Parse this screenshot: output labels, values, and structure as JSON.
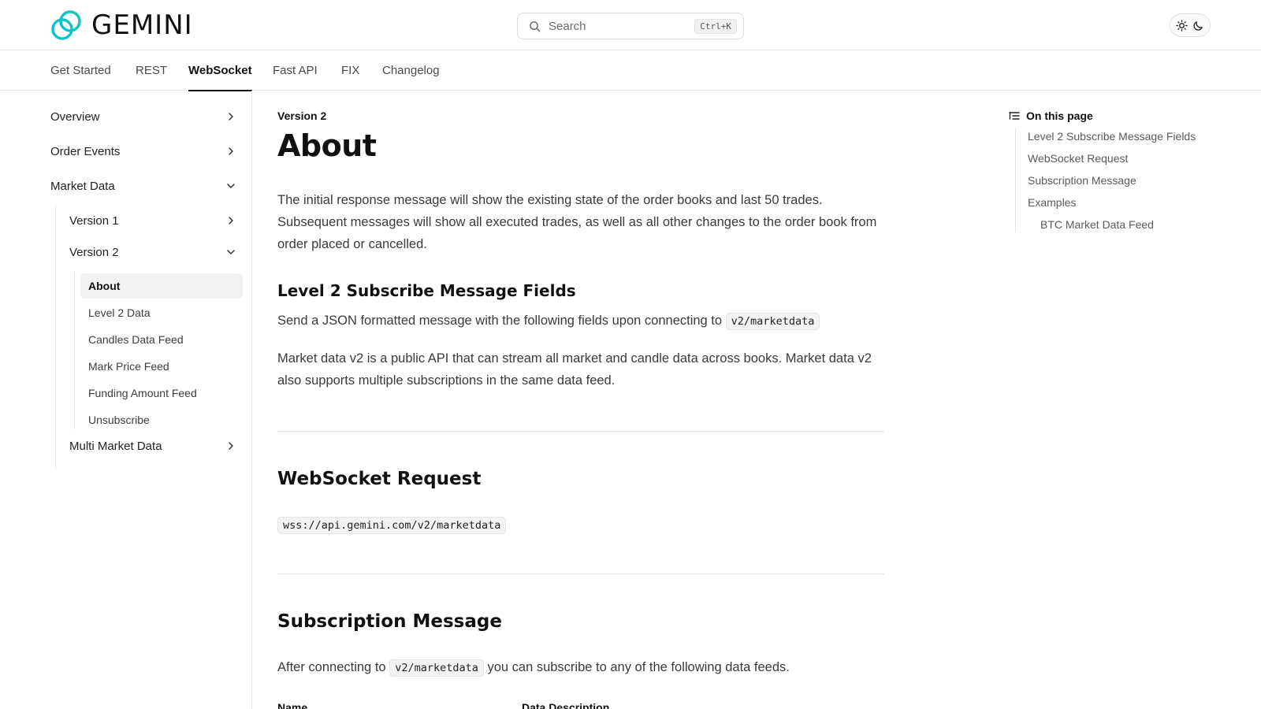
{
  "brand": {
    "name": "GEMINI",
    "logo_icon": "gemini-logo"
  },
  "search": {
    "placeholder": "Search",
    "shortcut": "Ctrl+K"
  },
  "theme": {
    "light_icon": "sun-icon",
    "dark_icon": "moon-icon"
  },
  "tabs": [
    {
      "label": "Get Started"
    },
    {
      "label": "REST"
    },
    {
      "label": "WebSocket",
      "active": true
    },
    {
      "label": "Fast API"
    },
    {
      "label": "FIX"
    },
    {
      "label": "Changelog"
    }
  ],
  "sidebar": {
    "sections": [
      {
        "label": "Overview",
        "state": "collapsed"
      },
      {
        "label": "Order Events",
        "state": "collapsed"
      },
      {
        "label": "Market Data",
        "state": "expanded"
      }
    ],
    "market_data": {
      "version1": {
        "label": "Version 1",
        "state": "collapsed"
      },
      "version2": {
        "label": "Version 2",
        "state": "expanded"
      },
      "version2_items": [
        {
          "label": "About",
          "active": true
        },
        {
          "label": "Level 2 Data"
        },
        {
          "label": "Candles Data Feed"
        },
        {
          "label": "Mark Price Feed"
        },
        {
          "label": "Funding Amount Feed"
        },
        {
          "label": "Unsubscribe"
        }
      ],
      "multi": {
        "label": "Multi Market Data",
        "state": "collapsed"
      }
    }
  },
  "content": {
    "eyebrow": "Version 2",
    "title": "About",
    "intro": "The initial response message will show the existing state of the order books and last 50 trades. Subsequent messages will show all executed trades, as well as all other changes to the order book from order placed or cancelled.",
    "level2": {
      "heading": "Level 2 Subscribe Message Fields",
      "p1_before": "Send a JSON formatted message with the following fields upon connecting to",
      "p1_code": "v2/marketdata",
      "p2": "Market data v2 is a public API that can stream all market and candle data across books. Market data v2 also supports multiple subscriptions in the same data feed."
    },
    "ws_request": {
      "heading": "WebSocket Request",
      "url": "wss://api.gemini.com/v2/marketdata"
    },
    "subscription": {
      "heading": "Subscription Message",
      "p_before": "After connecting to",
      "p_code": "v2/marketdata",
      "p_after": "you can subscribe to any of the following data feeds.",
      "table_headers": [
        "Name",
        "Data Description"
      ]
    }
  },
  "toc": {
    "heading": "On this page",
    "icon": "list-icon",
    "links": [
      {
        "label": "Level 2 Subscribe Message Fields"
      },
      {
        "label": "WebSocket Request"
      },
      {
        "label": "Subscription Message"
      },
      {
        "label": "Examples"
      },
      {
        "label": "BTC Market Data Feed",
        "nested": true
      }
    ]
  }
}
